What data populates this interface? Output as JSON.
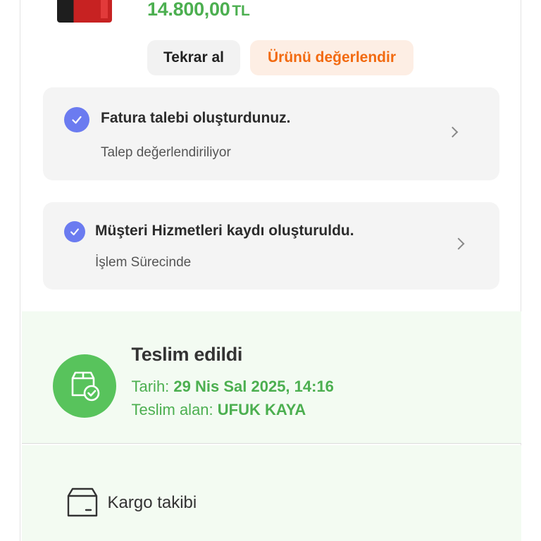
{
  "product": {
    "price": "14.800,00",
    "currency": "TL"
  },
  "actions": {
    "repeat_label": "Tekrar al",
    "review_label": "Ürünü değerlendir"
  },
  "requests": [
    {
      "title": "Fatura talebi oluşturdunuz.",
      "status": "Talep değerlendiriliyor",
      "icon": "check-circle-icon"
    },
    {
      "title": "Müşteri Hizmetleri kaydı oluşturuldu.",
      "status": "İşlem Sürecinde",
      "icon": "check-circle-icon"
    }
  ],
  "delivery": {
    "title": "Teslim edildi",
    "date_label": "Tarih:",
    "date_value": "29 Nis Sal 2025, 14:16",
    "receiver_label": "Teslim alan:",
    "receiver_value": "UFUK KAYA",
    "icon": "delivered-box-icon"
  },
  "tracking": {
    "label": "Kargo takibi",
    "icon": "package-icon"
  },
  "colors": {
    "price_green": "#4caf50",
    "accent_orange": "#f26a10",
    "check_blue": "#6b7bf0",
    "delivered_bg": "#f3fbf2",
    "delivered_circle": "#58c35c"
  }
}
